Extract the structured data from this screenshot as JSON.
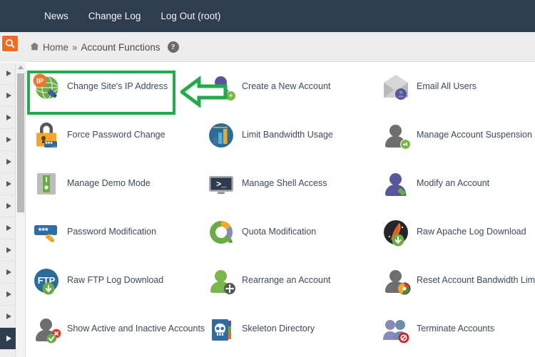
{
  "topnav": {
    "items": [
      {
        "label": "News",
        "name": "topnav-item-news"
      },
      {
        "label": "Change Log",
        "name": "topnav-item-change-log"
      },
      {
        "label": "Log Out (root)",
        "name": "topnav-item-log-out"
      }
    ]
  },
  "breadcrumb": {
    "home_label": "Home",
    "separator": "»",
    "current_label": "Account Functions",
    "help_glyph": "?",
    "search_icon": "search-icon"
  },
  "sidebar": {
    "item_count": 13,
    "active_index": 12,
    "collapsed": true,
    "scrollbar": {
      "thumb_position": "top",
      "up_arrow": "chevron-up-icon"
    }
  },
  "annotation": {
    "highlight_color": "#22ab4b",
    "arrow_color": "#22ab4b",
    "arrow_fill": "#ffffff",
    "highlight_target": "Change Site's IP Address",
    "arrow_direction": "left"
  },
  "colors": {
    "topnav_bg": "#2e3d50",
    "crumbbar_bg": "#ececec",
    "search_orange": "#f26b21",
    "label_text": "#3c4a5a",
    "accent_green": "#22ab4b"
  },
  "main": {
    "items": [
      {
        "label": "Change Site's IP Address",
        "icon": "globe-ip-edit-icon",
        "highlighted": true
      },
      {
        "label": "Create a New Account",
        "icon": "user-add-icon"
      },
      {
        "label": "Email All Users",
        "icon": "envelope-users-icon"
      },
      {
        "label": "Force Password Change",
        "icon": "padlock-password-icon"
      },
      {
        "label": "Limit Bandwidth Usage",
        "icon": "bar-chart-circle-icon"
      },
      {
        "label": "Manage Account Suspension",
        "icon": "user-pause-icon"
      },
      {
        "label": "Manage Demo Mode",
        "icon": "toggle-switch-icon"
      },
      {
        "label": "Manage Shell Access",
        "icon": "terminal-icon"
      },
      {
        "label": "Modify an Account",
        "icon": "user-edit-icon"
      },
      {
        "label": "Password Modification",
        "icon": "password-field-edit-icon"
      },
      {
        "label": "Quota Modification",
        "icon": "donut-chart-edit-icon"
      },
      {
        "label": "Raw Apache Log Download",
        "icon": "apache-feather-download-icon"
      },
      {
        "label": "Raw FTP Log Download",
        "icon": "ftp-download-icon"
      },
      {
        "label": "Rearrange an Account",
        "icon": "user-move-icon"
      },
      {
        "label": "Reset Account Bandwidth Limit",
        "icon": "user-reset-icon"
      },
      {
        "label": "Show Active and Inactive Accounts",
        "icon": "user-status-icon"
      },
      {
        "label": "Skeleton Directory",
        "icon": "skull-folder-icon"
      },
      {
        "label": "Terminate Accounts",
        "icon": "users-terminate-icon"
      }
    ]
  }
}
